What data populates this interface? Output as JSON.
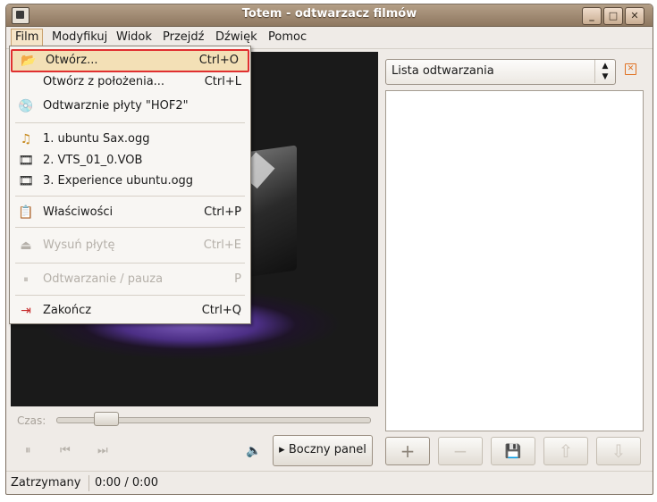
{
  "window": {
    "title": "Totem - odtwarzacz filmów"
  },
  "titlebar_buttons": [
    "_",
    "□",
    "✕"
  ],
  "menubar": {
    "items": [
      "Film",
      "Modyfikuj",
      "Widok",
      "Przejdź",
      "Dźwięk",
      "Pomoc"
    ]
  },
  "file_menu": {
    "open": {
      "label": "Otwórz...",
      "accel": "Ctrl+O"
    },
    "open_location": {
      "label": "Otwórz z położenia...",
      "accel": "Ctrl+L"
    },
    "play_disc": {
      "label": "Odtwarznie płyty \"HOF2\""
    },
    "recent": [
      {
        "label": "1. ubuntu Sax.ogg"
      },
      {
        "label": "2. VTS_01_0.VOB"
      },
      {
        "label": "3. Experience ubuntu.ogg"
      }
    ],
    "properties": {
      "label": "Właściwości",
      "accel": "Ctrl+P"
    },
    "eject": {
      "label": "Wysuń płytę",
      "accel": "Ctrl+E"
    },
    "play_pause": {
      "label": "Odtwarzanie / pauza",
      "accel": "P"
    },
    "quit": {
      "label": "Zakończ",
      "accel": "Ctrl+Q"
    }
  },
  "player": {
    "seek_label": "Czas:",
    "seek_position": 0.13,
    "side_panel_label": "Boczny panel",
    "controls": {
      "pause": "⏸",
      "prev": "⏮",
      "next": "⏭"
    }
  },
  "playlist": {
    "combo_value": "Lista odtwarzania",
    "buttons": [
      "+",
      "−",
      "💾",
      "⇧",
      "⇩"
    ]
  },
  "status": {
    "state": "Zatrzymany",
    "time": "0:00 / 0:00"
  },
  "colors": {
    "highlight_border": "#e03030",
    "accent": "#e07020"
  }
}
